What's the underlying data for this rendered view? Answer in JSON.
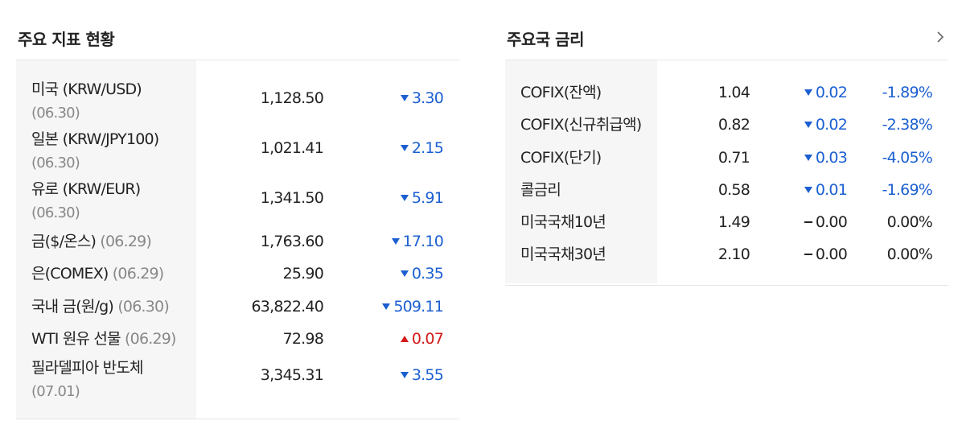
{
  "indicators": {
    "title": "주요 지표 현황",
    "rows": [
      {
        "name": "미국 (KRW/USD)",
        "date": "(06.30)",
        "value": "1,128.50",
        "change": "3.30",
        "direction": "down"
      },
      {
        "name": "일본 (KRW/JPY100)",
        "date": "(06.30)",
        "value": "1,021.41",
        "change": "2.15",
        "direction": "down"
      },
      {
        "name": "유로 (KRW/EUR)",
        "date": "(06.30)",
        "value": "1,341.50",
        "change": "5.91",
        "direction": "down"
      },
      {
        "name": "금($/온스)",
        "date": "(06.29)",
        "value": "1,763.60",
        "change": "17.10",
        "direction": "down"
      },
      {
        "name": "은(COMEX)",
        "date": "(06.29)",
        "value": "25.90",
        "change": "0.35",
        "direction": "down"
      },
      {
        "name": "국내 금(원/g)",
        "date": "(06.30)",
        "value": "63,822.40",
        "change": "509.11",
        "direction": "down"
      },
      {
        "name": "WTI 원유 선물",
        "date": "(06.29)",
        "value": "72.98",
        "change": "0.07",
        "direction": "up"
      },
      {
        "name": "필라델피아 반도체",
        "date": "(07.01)",
        "value": "3,345.31",
        "change": "3.55",
        "direction": "down"
      }
    ]
  },
  "rates": {
    "title": "주요국 금리",
    "rows": [
      {
        "name": "COFIX(잔액)",
        "value": "1.04",
        "change": "0.02",
        "percent": "-1.89%",
        "direction": "down"
      },
      {
        "name": "COFIX(신규취급액)",
        "value": "0.82",
        "change": "0.02",
        "percent": "-2.38%",
        "direction": "down"
      },
      {
        "name": "COFIX(단기)",
        "value": "0.71",
        "change": "0.03",
        "percent": "-4.05%",
        "direction": "down"
      },
      {
        "name": "콜금리",
        "value": "0.58",
        "change": "0.01",
        "percent": "-1.69%",
        "direction": "down"
      },
      {
        "name": "미국국채10년",
        "value": "1.49",
        "change": "0.00",
        "percent": "0.00%",
        "direction": "flat"
      },
      {
        "name": "미국국채30년",
        "value": "2.10",
        "change": "0.00",
        "percent": "0.00%",
        "direction": "flat"
      }
    ]
  },
  "colors": {
    "down": "#1b5fd1",
    "up": "#d31919",
    "flat": "#222222",
    "date": "#888888"
  }
}
